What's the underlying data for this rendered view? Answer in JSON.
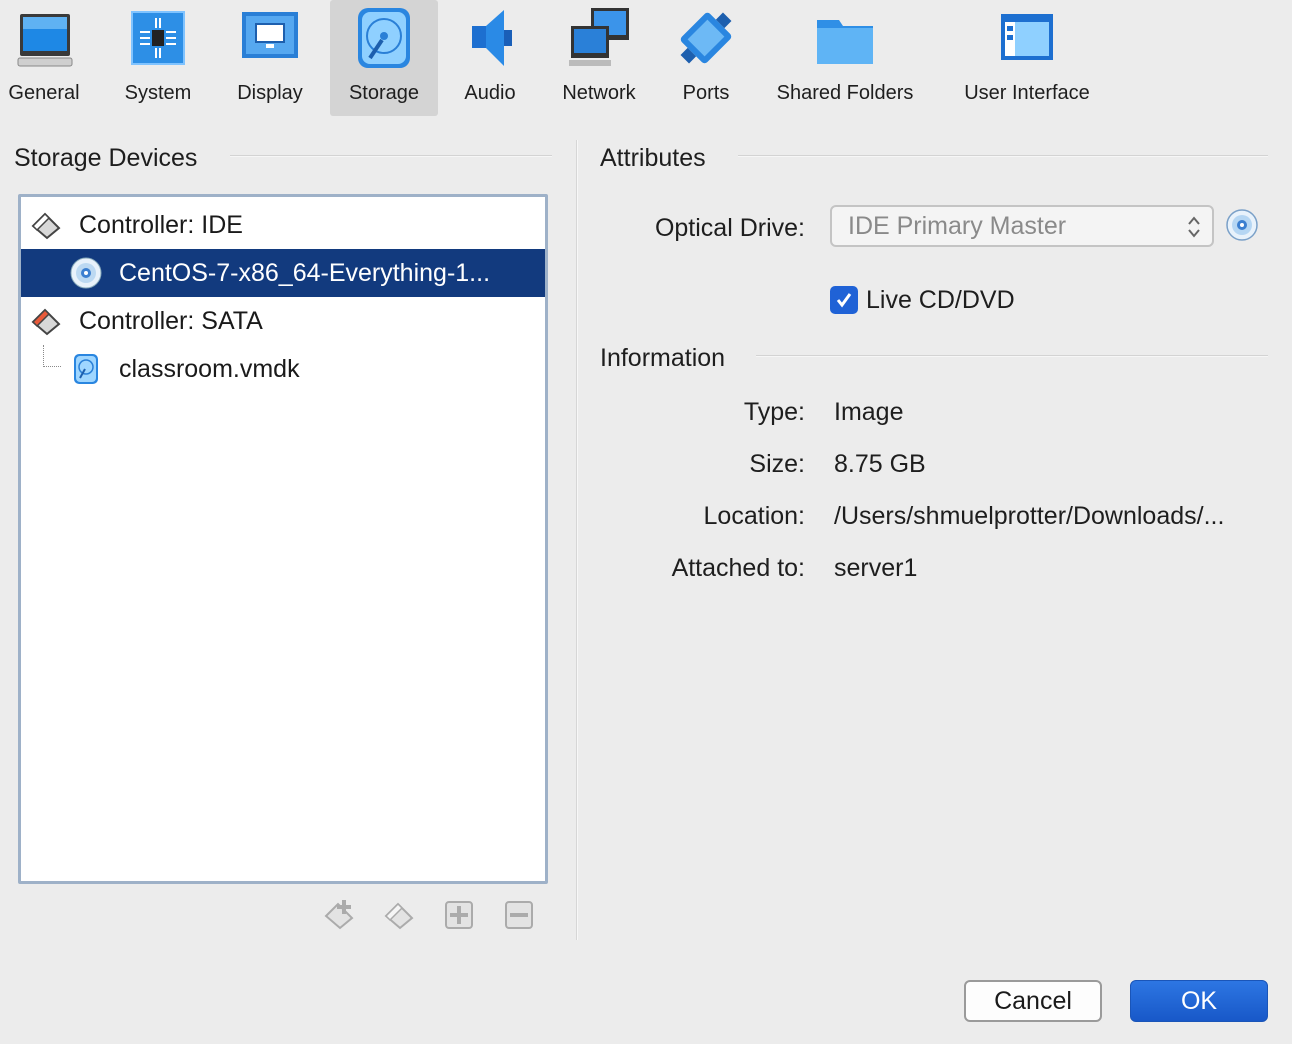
{
  "toolbar": {
    "items": [
      {
        "label": "General",
        "icon": "monitor-general-icon"
      },
      {
        "label": "System",
        "icon": "chip-icon"
      },
      {
        "label": "Display",
        "icon": "display-icon"
      },
      {
        "label": "Storage",
        "icon": "storage-disk-icon",
        "active": true
      },
      {
        "label": "Audio",
        "icon": "speaker-icon"
      },
      {
        "label": "Network",
        "icon": "network-icon"
      },
      {
        "label": "Ports",
        "icon": "serial-port-icon"
      },
      {
        "label": "Shared Folders",
        "icon": "folder-icon"
      },
      {
        "label": "User Interface",
        "icon": "window-ui-icon"
      }
    ]
  },
  "storage": {
    "title": "Storage Devices",
    "tree": [
      {
        "label": "Controller: IDE",
        "icon": "ide-controller-icon"
      },
      {
        "label": "CentOS-7-x86_64-Everything-1...",
        "icon": "optical-disc-icon",
        "selected": true
      },
      {
        "label": "Controller: SATA",
        "icon": "sata-controller-icon"
      },
      {
        "label": "classroom.vmdk",
        "icon": "hard-disk-icon"
      }
    ]
  },
  "attributes": {
    "title": "Attributes",
    "optical_drive_label": "Optical Drive:",
    "optical_drive_value": "IDE Primary Master",
    "live_cd_label": "Live CD/DVD",
    "live_cd_checked": true
  },
  "information": {
    "title": "Information",
    "type_label": "Type:",
    "type_value": "Image",
    "size_label": "Size:",
    "size_value": "8.75 GB",
    "location_label": "Location:",
    "location_value": "/Users/shmuelprotter/Downloads/...",
    "attached_label": "Attached to:",
    "attached_value": "server1"
  },
  "buttons": {
    "cancel": "Cancel",
    "ok": "OK"
  },
  "colors": {
    "selection": "#123a7e",
    "accent": "#1f62d6",
    "background": "#ececec"
  }
}
